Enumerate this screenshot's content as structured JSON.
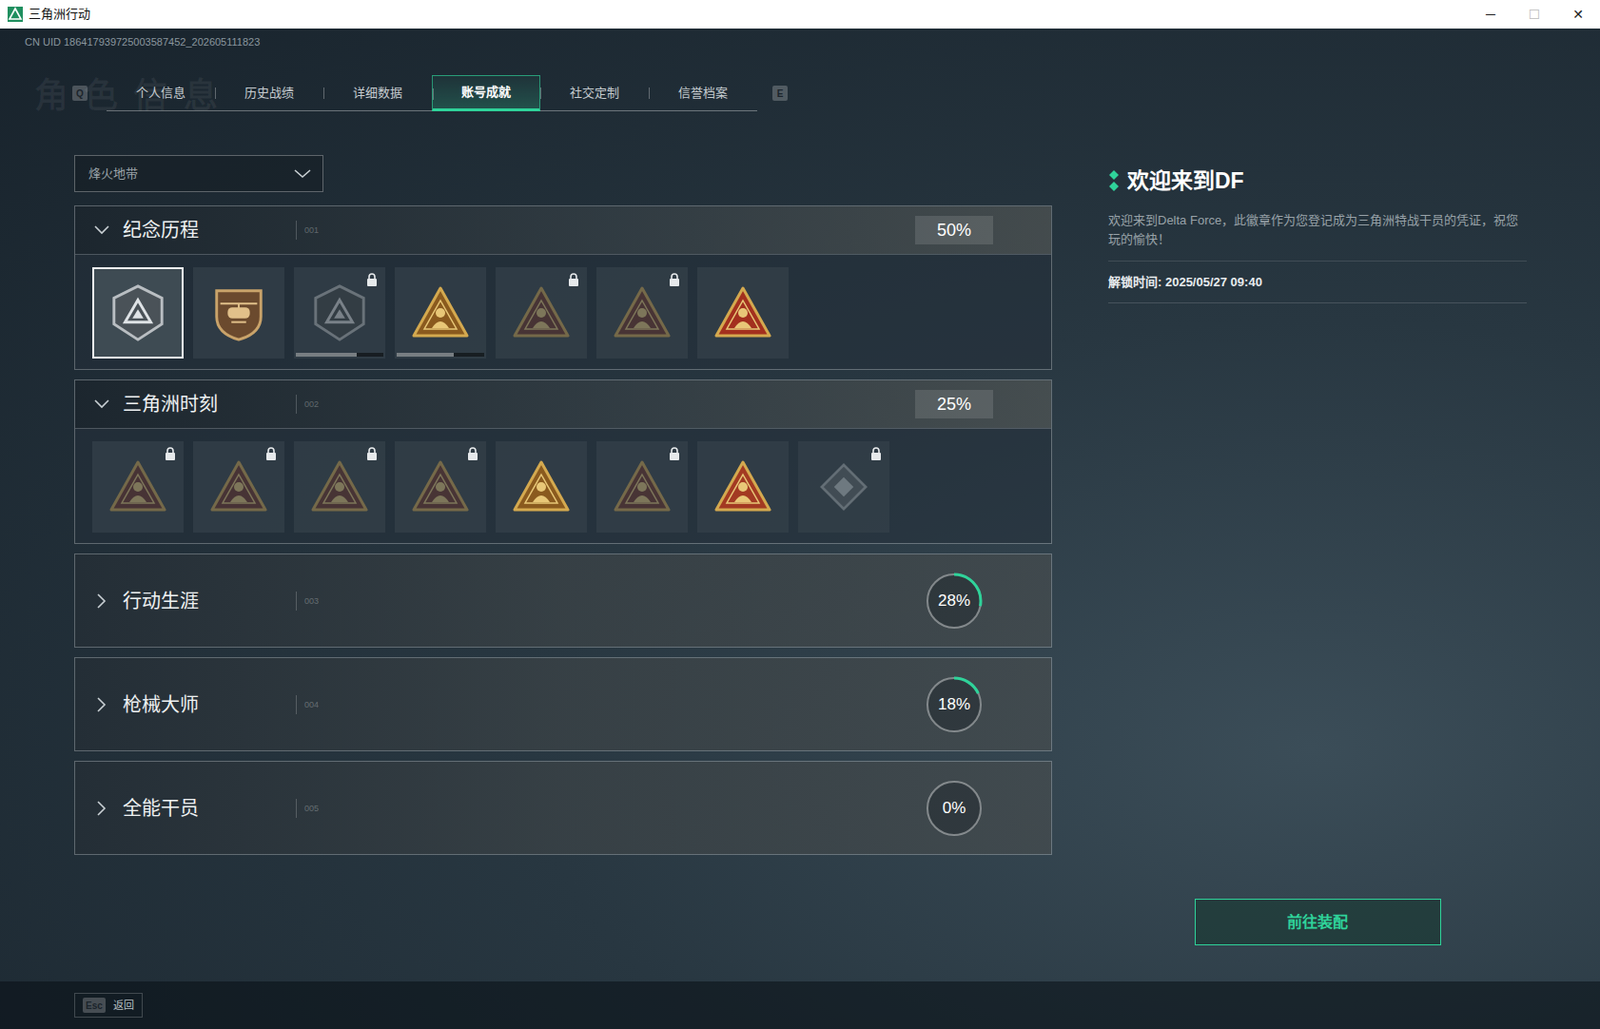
{
  "window": {
    "title": "三角洲行动",
    "controls": [
      {
        "glyph": "─",
        "disabled": false
      },
      {
        "glyph": "☐",
        "disabled": true
      },
      {
        "glyph": "✕",
        "disabled": false
      }
    ]
  },
  "uid": "CN UID 186417939725003587452_202605111823",
  "watermark": "角色信息",
  "tab_keys": {
    "prev": "Q",
    "next": "E"
  },
  "tabs": [
    {
      "label": "个人信息",
      "selected": false
    },
    {
      "label": "历史战绩",
      "selected": false
    },
    {
      "label": "详细数据",
      "selected": false
    },
    {
      "label": "账号成就",
      "selected": true
    },
    {
      "label": "社交定制",
      "selected": false
    },
    {
      "label": "信誉档案",
      "selected": false
    }
  ],
  "mode_select": {
    "value": "烽火地带",
    "expanded": false
  },
  "sections": [
    {
      "title": "纪念历程",
      "code": "001",
      "progress": "50%",
      "expanded": true,
      "badges": [
        {
          "kind": "hex",
          "locked": false,
          "selected": true,
          "color": "#4a5258"
        },
        {
          "kind": "shield",
          "locked": false,
          "selected": false,
          "color": "#6b4a2e"
        },
        {
          "kind": "hex",
          "locked": true,
          "selected": false,
          "color": "#3a4044",
          "level": 0.7
        },
        {
          "kind": "triangle",
          "locked": false,
          "selected": false,
          "color": "#8a5a1e",
          "level": 0.65
        },
        {
          "kind": "triangle",
          "locked": true,
          "selected": false,
          "color": "#6a2a20"
        },
        {
          "kind": "triangle",
          "locked": true,
          "selected": false,
          "color": "#6a2a20"
        },
        {
          "kind": "triangle",
          "locked": false,
          "selected": false,
          "color": "#a3301e"
        }
      ]
    },
    {
      "title": "三角洲时刻",
      "code": "002",
      "progress": "25%",
      "expanded": true,
      "badges": [
        {
          "kind": "triangle",
          "locked": true,
          "selected": false,
          "color": "#6a2a20"
        },
        {
          "kind": "triangle",
          "locked": true,
          "selected": false,
          "color": "#6a2a20"
        },
        {
          "kind": "triangle",
          "locked": true,
          "selected": false,
          "color": "#6a2a20"
        },
        {
          "kind": "triangle",
          "locked": true,
          "selected": false,
          "color": "#6a2a20"
        },
        {
          "kind": "triangle",
          "locked": false,
          "selected": false,
          "color": "#8a5a1e"
        },
        {
          "kind": "triangle",
          "locked": true,
          "selected": false,
          "color": "#6a2a20"
        },
        {
          "kind": "triangle",
          "locked": false,
          "selected": false,
          "color": "#a33a22"
        },
        {
          "kind": "diamond",
          "locked": true,
          "selected": false,
          "color": "#5a6268"
        }
      ]
    },
    {
      "title": "行动生涯",
      "code": "003",
      "progress": "28%",
      "expanded": false,
      "level": 0.28
    },
    {
      "title": "枪械大师",
      "code": "004",
      "progress": "18%",
      "expanded": false,
      "level": 0.18
    },
    {
      "title": "全能干员",
      "code": "005",
      "progress": "0%",
      "expanded": false,
      "level": 0
    }
  ],
  "detail": {
    "title": "欢迎来到DF",
    "description": "欢迎来到Delta Force，此徽章作为您登记成为三角洲特战干员的凭证，祝您玩的愉快！",
    "unlock_time": "解锁时间: 2025/05/27 09:40"
  },
  "equip_button": "前往装配",
  "back": {
    "key": "Esc",
    "label": "返回"
  }
}
